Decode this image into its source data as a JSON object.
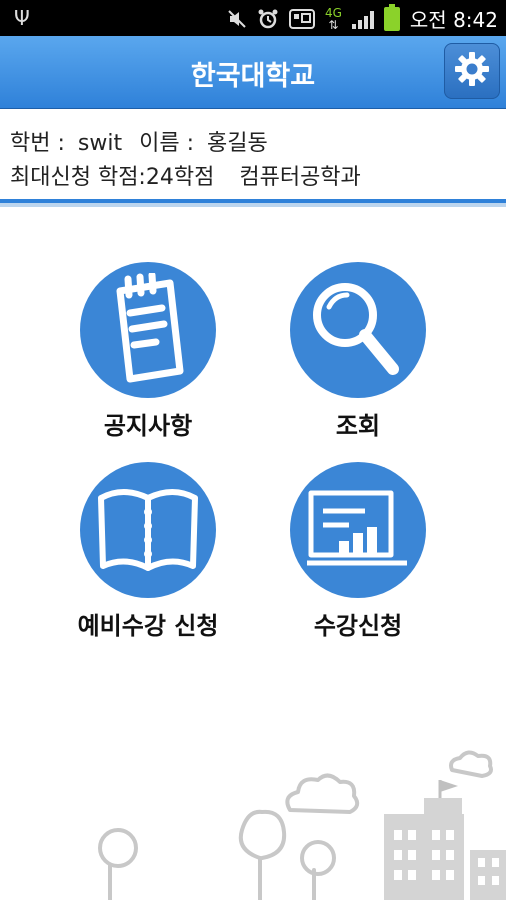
{
  "status_bar": {
    "time_prefix": "오전",
    "time": "8:42",
    "network": "4G",
    "icons": [
      "usb-icon",
      "mute-icon",
      "alarm-icon",
      "app-icon",
      "4g-icon",
      "signal-icon",
      "battery-icon"
    ]
  },
  "app": {
    "title": "한국대학교",
    "settings_icon": "gear-icon",
    "accent_color": "#2f81d9"
  },
  "user_info": {
    "student_id_label": "학번 :",
    "student_id": "swit",
    "name_label": "이름 :",
    "name": "홍길동",
    "max_credits_label": "최대신청 학점:",
    "max_credits": "24학점",
    "department": "컴퓨터공학과"
  },
  "menu": [
    {
      "label": "공지사항",
      "icon": "notepad-icon"
    },
    {
      "label": "조회",
      "icon": "magnifier-icon"
    },
    {
      "label": "예비수강 신청",
      "icon": "book-icon"
    },
    {
      "label": "수강신청",
      "icon": "board-icon"
    }
  ]
}
